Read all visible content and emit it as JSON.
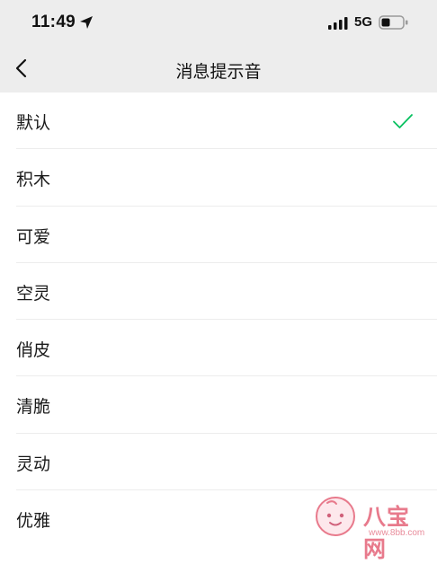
{
  "status_bar": {
    "time": "11:49",
    "network": "5G",
    "icons": [
      "location-arrow-icon",
      "signal-bars-icon",
      "battery-icon"
    ]
  },
  "nav": {
    "title": "消息提示音",
    "back_icon": "chevron-left-icon"
  },
  "sounds": [
    {
      "label": "默认",
      "selected": true
    },
    {
      "label": "积木",
      "selected": false
    },
    {
      "label": "可爱",
      "selected": false
    },
    {
      "label": "空灵",
      "selected": false
    },
    {
      "label": "俏皮",
      "selected": false
    },
    {
      "label": "清脆",
      "selected": false
    },
    {
      "label": "灵动",
      "selected": false
    },
    {
      "label": "优雅",
      "selected": false
    }
  ],
  "watermark": {
    "text": "八宝网",
    "url": "www.8bb.com",
    "color": "#e87a8c"
  },
  "colors": {
    "header_bg": "#ededed",
    "check": "#07c160",
    "list_bg": "#ffffff"
  }
}
